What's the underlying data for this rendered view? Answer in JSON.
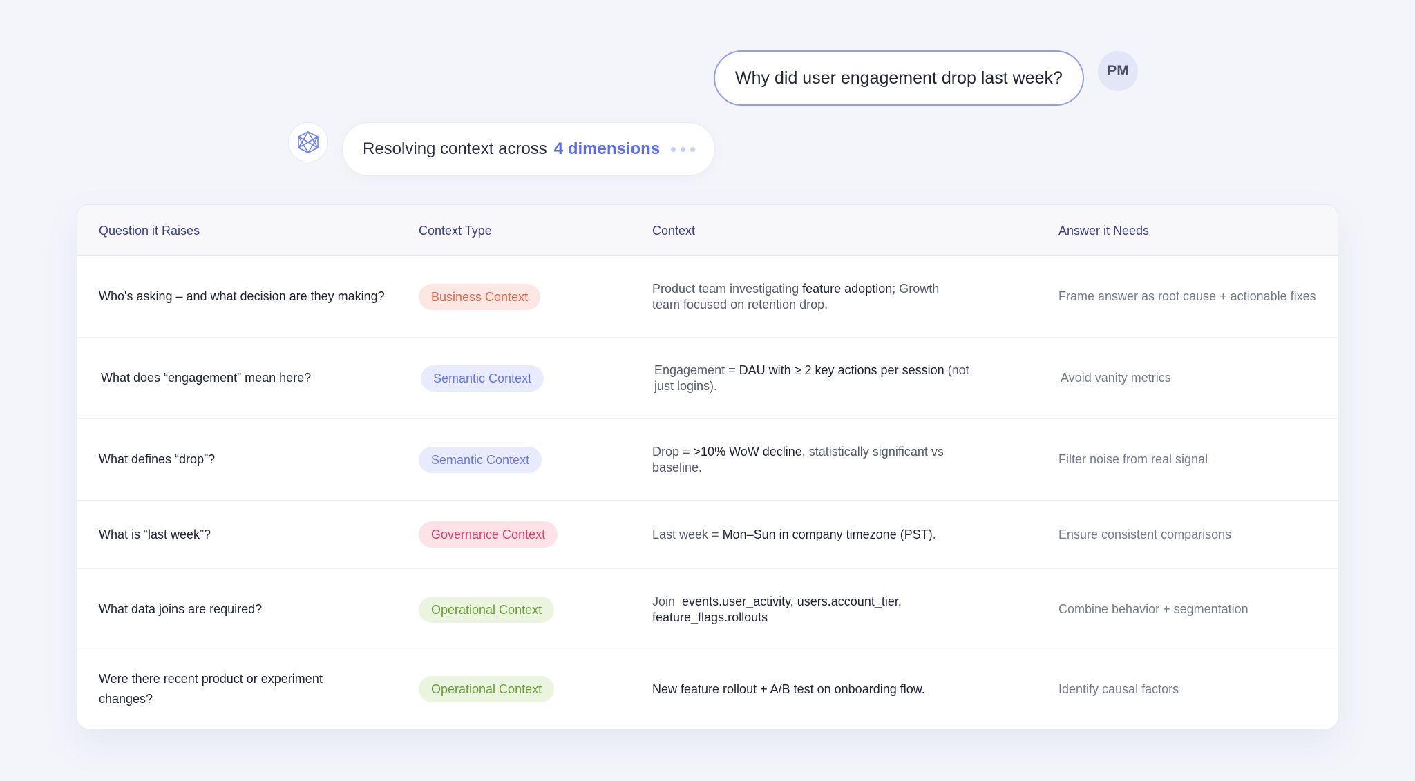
{
  "user_message": {
    "text": "Why did user engagement drop last week?",
    "avatar_initials": "PM"
  },
  "agent_status": {
    "prefix": "Resolving context across",
    "highlight": "4 dimensions",
    "logo_icon": "lattice-logo-icon"
  },
  "colors": {
    "accent": "#5b6ef0",
    "header_text": "#3a3f8c",
    "business": "#e8604a",
    "semantic": "#6676e8",
    "governance": "#e0406a",
    "operational": "#6a9f36"
  },
  "table": {
    "headers": {
      "question": "Question it Raises",
      "context_type": "Context Type",
      "context": "Context",
      "answer": "Answer it Needs"
    },
    "rows": [
      {
        "question": "Who's asking – and what decision are they making?",
        "context_type": "Business Context",
        "context_parts": [
          "Product team investigating ",
          "feature adoption",
          "; Growth team focused on retention drop."
        ],
        "answer": "Frame answer as root cause + actionable fixes"
      },
      {
        "question": "What does “engagement” mean here?",
        "context_type": "Semantic Context",
        "context_parts": [
          "Engagement = ",
          "DAU with ≥ 2 key actions per session",
          " (not just logins)."
        ],
        "answer": "Avoid vanity metrics"
      },
      {
        "question": "What defines “drop”?",
        "context_type": "Semantic Context",
        "context_parts": [
          "Drop = ",
          ">10% WoW decline",
          ", statistically significant vs baseline."
        ],
        "answer": "Filter noise from real signal"
      },
      {
        "question": "What is “last week”?",
        "context_type": "Governance Context",
        "context_parts": [
          "Last week = ",
          "Mon–Sun in company timezone (PST)",
          "."
        ],
        "answer": "Ensure consistent comparisons"
      },
      {
        "question": "What data joins are required?",
        "context_type": "Operational Context",
        "context_parts": [
          "Join  ",
          "events.user_activity, users.account_tier, feature_flags.rollouts",
          ""
        ],
        "answer": "Combine behavior + segmentation"
      },
      {
        "question": "Were there recent product or experiment changes?",
        "context_type": "Operational Context",
        "context_parts": [
          "",
          "New feature rollout + A/B test on onboarding flow.",
          ""
        ],
        "answer": "Identify causal factors"
      }
    ]
  }
}
